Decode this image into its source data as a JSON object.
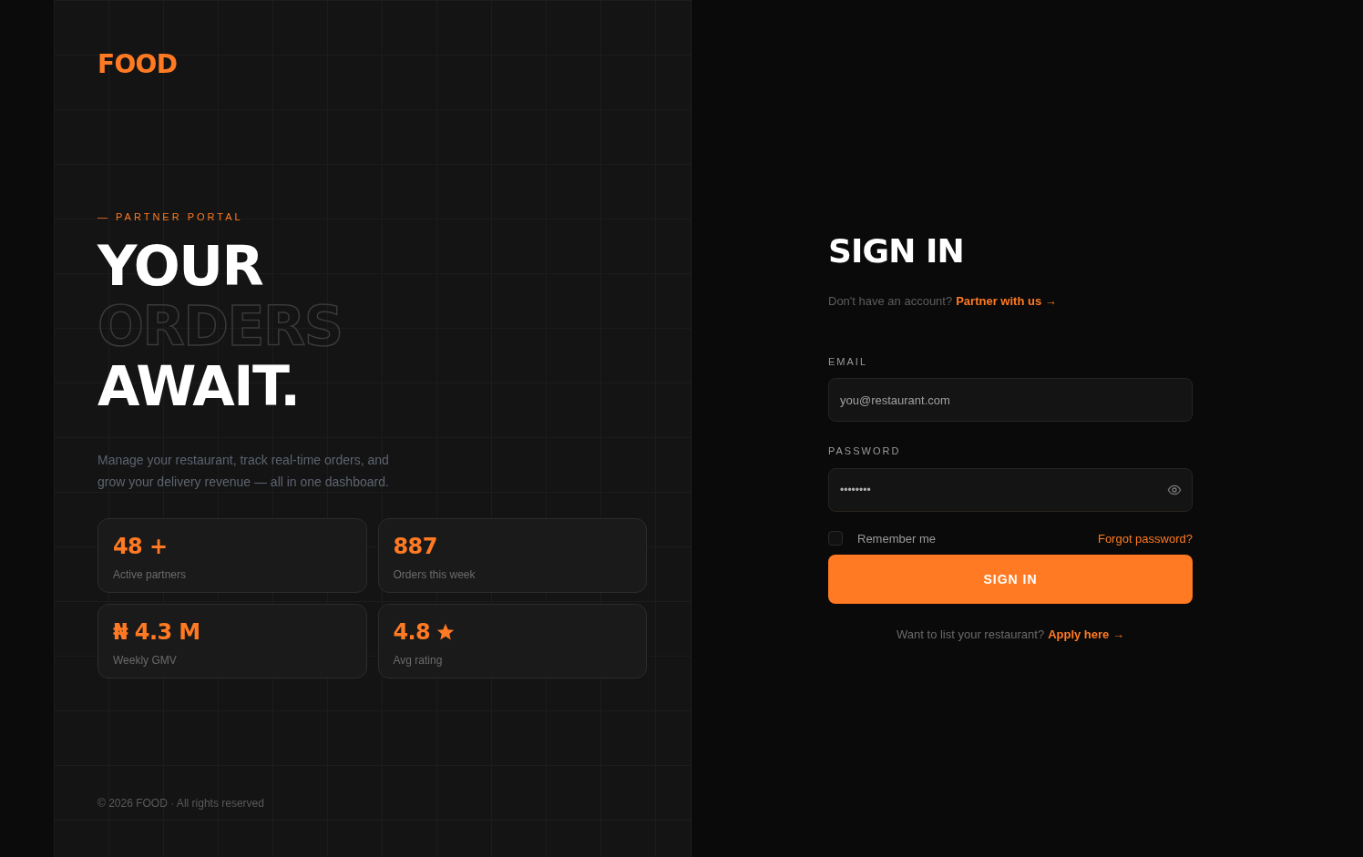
{
  "brand": {
    "logo": "FOOD"
  },
  "hero": {
    "eyebrow": "— PARTNER PORTAL",
    "headline": [
      {
        "text": "YOUR",
        "kind": "solid"
      },
      {
        "text": "ORDERS",
        "kind": "outline"
      },
      {
        "text": "AWAIT.",
        "kind": "solid"
      }
    ],
    "description": "Manage your restaurant, track real-time orders, and grow your delivery revenue — all in one dashboard."
  },
  "stats": [
    {
      "value": "48 +",
      "label": "Active partners",
      "star": false
    },
    {
      "value": "887",
      "label": "Orders this week",
      "star": false
    },
    {
      "value": "₦ 4.3 M",
      "label": "Weekly GMV",
      "star": false
    },
    {
      "value": "4.8",
      "label": "Avg rating",
      "star": true
    }
  ],
  "footer": "© 2026 FOOD · All rights reserved",
  "form": {
    "title": "SIGN IN",
    "prompt": "Don't have an account?",
    "prompt_link": "Partner with us →",
    "email": {
      "label": "EMAIL",
      "placeholder": "you@restaurant.com"
    },
    "password": {
      "label": "PASSWORD",
      "value": "••••••••"
    },
    "remember": {
      "label": "Remember me",
      "checked": false
    },
    "forgot": "Forgot password?",
    "submit": "SIGN IN",
    "apply_prompt": "Want to list your restaurant?",
    "apply_link": "Apply here →"
  }
}
